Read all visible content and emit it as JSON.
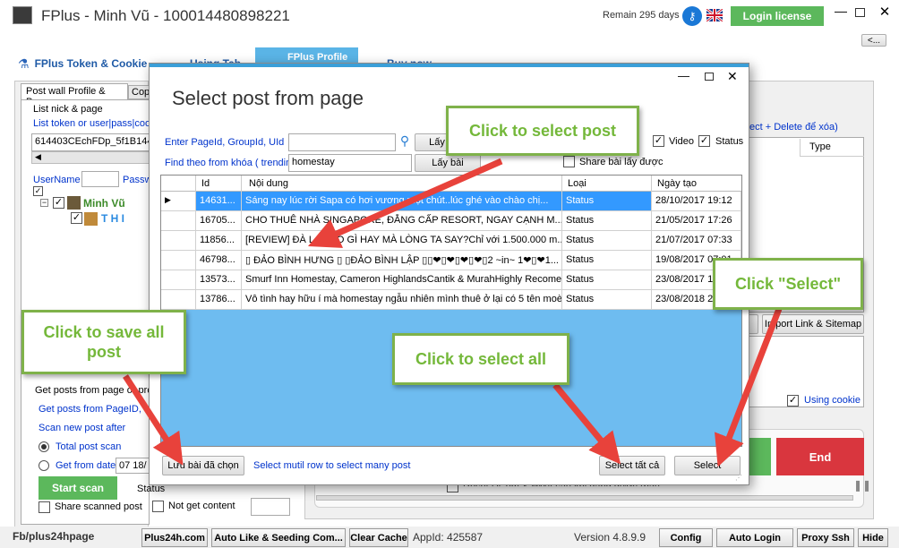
{
  "window": {
    "title": "FPlus - Minh Vũ - 100014480898221",
    "remain": "Remain 295 days",
    "login_btn": "Login license",
    "collapse_btn": "<..."
  },
  "main_tabs": [
    {
      "label": "FPlus Token & Cookie"
    },
    {
      "label": "Using Tab"
    },
    {
      "label": "FPlus Profile"
    },
    {
      "label": "Buy now"
    }
  ],
  "sub_tabs": [
    {
      "label": "Post wall Profile & Page"
    },
    {
      "label": "Cop"
    }
  ],
  "left": {
    "list_nick": "List nick & page",
    "list_token": "List token or user|pass|cook",
    "token_value": "614403CEchFDp_5f1B144",
    "username_label": "UserName",
    "pass_label": "Passw",
    "tree_items": [
      "Minh Vũ",
      "T H I"
    ],
    "get_posts_label": "Get posts from page or prof",
    "get_posts_link": "Get posts from PageID,",
    "scan_new": "Scan new post after",
    "total_scan": "Total post scan",
    "get_from_date": "Get from date",
    "date_value": "07 18/",
    "start_scan": "Start scan",
    "status_label": "Status",
    "share_scanned": "Share scanned post",
    "not_get_content": "Not get content"
  },
  "right": {
    "select_delete": "ect + Delete để xóa)",
    "type_header": "Type",
    "import_btn": "Import Link & Sitemap",
    "using_cookie": "Using cookie",
    "end_btn": "End",
    "bottom_text": "Reset DCom & HMA sau khi đăng được (bài)"
  },
  "dialog": {
    "title": "Select post from page",
    "enter_page": "Enter PageId, GroupId, UId",
    "find_keyword": "Find theo from khóa ( trending",
    "keyword_value": "homestay",
    "get_btn1": "Lấy",
    "get_btn2": "Lấy bài",
    "video_label": "Video",
    "status_opt": "Status",
    "share_label": "Share bài lấy được",
    "columns": [
      "Id",
      "Nội dung",
      "Loại",
      "Ngày tạo"
    ],
    "rows": [
      {
        "id": "14631...",
        "content": "Sáng nay lúc rời Sapa có hơi vương một chút..lúc ghé vào chào chị...",
        "type": "Status",
        "date": "28/10/2017 19:12"
      },
      {
        "id": "16705...",
        "content": "CHO THUÊ NHÀ SINGAPORE, ĐẲNG CẤP RESORT, NGAY CẠNH M...",
        "type": "Status",
        "date": "21/05/2017 17:26"
      },
      {
        "id": "11856...",
        "content": "[REVIEW] ĐÀ LẠT CÓ GÌ HAY MÀ LÒNG TA SAY?Chỉ với 1.500.000 m...",
        "type": "Status",
        "date": "21/07/2017 07:33"
      },
      {
        "id": "46798...",
        "content": "▯ ĐẢO BÌNH HƯNG ▯  ▯ĐẢO BÌNH LẬP ▯▯❤▯❤▯❤▯❤▯2 ~in~ 1❤▯❤1...",
        "type": "Status",
        "date": "19/08/2017 07:01"
      },
      {
        "id": "13573...",
        "content": "Smurf Inn Homestay, Cameron HighlandsCantik & MurahHighly Recome...",
        "type": "Status",
        "date": "23/08/2017 18:31"
      },
      {
        "id": "13786...",
        "content": "Vô tình hay hữu í mà homestay ngẫu nhiên mình thuê ở lại có 5 tên moè...",
        "type": "Status",
        "date": "23/08/2018 23:53"
      }
    ],
    "save_btn": "Lưu bài đã chọn",
    "hint": "Select mutil row to select many post",
    "select_all_btn": "Select tất cả",
    "select_btn": "Select"
  },
  "callouts": {
    "select_post": "Click to select post",
    "save_all": "Click to save all post",
    "select_all": "Click to select all",
    "select": "Click \"Select\""
  },
  "statusbar": {
    "left_text": "Fb/plus24hpage",
    "items": [
      "Plus24h.com",
      "Auto Like & Seeding Com...",
      "Clear Cache"
    ],
    "appid": "AppId: 425587",
    "version": "Version 4.8.9.9",
    "right_items": [
      "Config",
      "Auto Login",
      "Proxy Ssh",
      "Hide"
    ]
  },
  "colors": {
    "green_btn": "#5cb85c",
    "end_btn": "#d9363e",
    "grid_bg": "#6ebcf0",
    "selected_row": "#cce6ff",
    "callout_text": "#74b83a",
    "arrow": "#e8423b"
  }
}
